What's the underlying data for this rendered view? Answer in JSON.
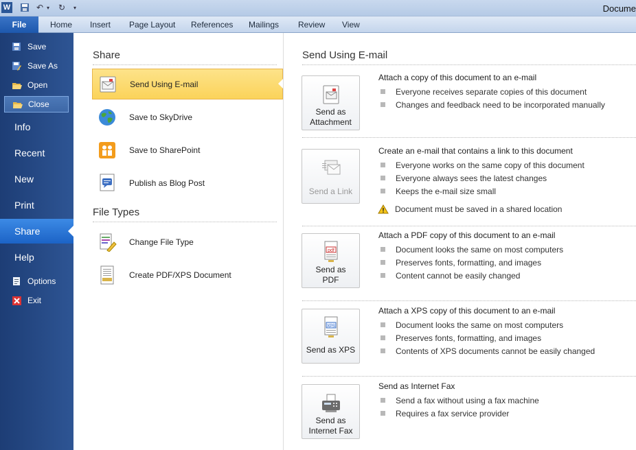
{
  "window": {
    "title": "Docume"
  },
  "ribbon": {
    "file": "File",
    "tabs": [
      "Home",
      "Insert",
      "Page Layout",
      "References",
      "Mailings",
      "Review",
      "View"
    ]
  },
  "backstage": {
    "small_top": [
      "Save",
      "Save As",
      "Open",
      "Close"
    ],
    "big": [
      "Info",
      "Recent",
      "New",
      "Print",
      "Share",
      "Help"
    ],
    "small_bottom": [
      "Options",
      "Exit"
    ]
  },
  "share": {
    "heading": "Share",
    "items": [
      "Send Using E-mail",
      "Save to SkyDrive",
      "Save to SharePoint",
      "Publish as Blog Post"
    ],
    "file_types_heading": "File Types",
    "file_types": [
      "Change File Type",
      "Create PDF/XPS Document"
    ]
  },
  "send": {
    "title": "Send Using E-mail",
    "options": [
      {
        "button": [
          "Send as",
          "Attachment"
        ],
        "heading": "Attach a copy of this document to an e-mail",
        "bullets": [
          "Everyone receives separate copies of this document",
          "Changes and feedback need to be incorporated manually"
        ]
      },
      {
        "button": [
          "Send a Link"
        ],
        "heading": "Create an e-mail that contains a link to this document",
        "bullets": [
          "Everyone works on the same copy of this document",
          "Everyone always sees the latest changes",
          "Keeps the e-mail size small"
        ],
        "warning": "Document must be saved in a shared location"
      },
      {
        "button": [
          "Send as",
          "PDF"
        ],
        "heading": "Attach a PDF copy of this document to an e-mail",
        "bullets": [
          "Document looks the same on most computers",
          "Preserves fonts, formatting, and images",
          "Content cannot be easily changed"
        ]
      },
      {
        "button": [
          "Send as XPS"
        ],
        "heading": "Attach a XPS copy of this document to an e-mail",
        "bullets": [
          "Document looks the same on most computers",
          "Preserves fonts, formatting, and images",
          "Contents of XPS documents cannot be easily changed"
        ]
      },
      {
        "button": [
          "Send as",
          "Internet Fax"
        ],
        "heading": "Send as Internet Fax",
        "bullets": [
          "Send a fax without using a fax machine",
          "Requires a fax service provider"
        ]
      }
    ],
    "icons": {
      "pdf": "pdf",
      "xps": "XPS"
    }
  }
}
